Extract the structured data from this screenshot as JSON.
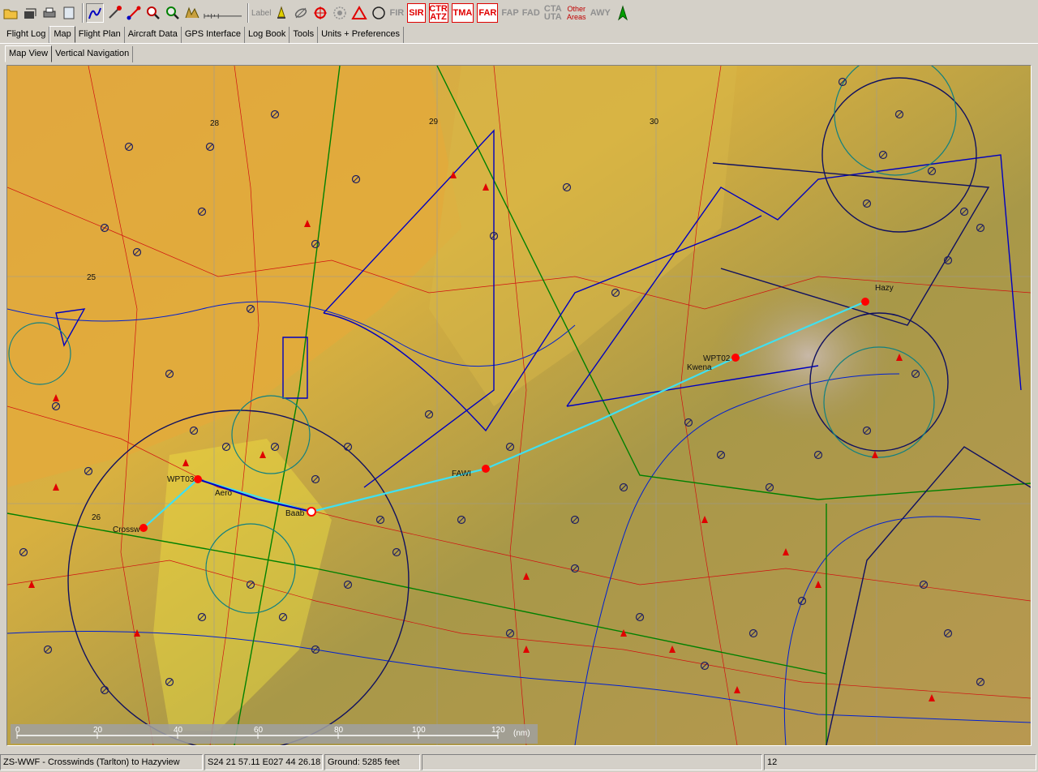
{
  "toolbar": {
    "label_tool": "Label",
    "airspace_buttons": [
      "FIR",
      "SIR",
      "CTR ATZ",
      "TMA",
      "FAR",
      "FAP",
      "FAD",
      "CTA UTA",
      "Other Areas",
      "AWY"
    ],
    "icons": [
      "open-folder-icon",
      "open-file-icon",
      "print-icon",
      "page-setup-icon",
      "route-draw-icon",
      "route-edit-icon",
      "line-tool-icon",
      "zoom-in-icon",
      "zoom-out-icon",
      "terrain-icon",
      "scale-bar-icon",
      "airport-icon",
      "airfield-icon",
      "navaid-vor-icon",
      "navaid-ndb-icon",
      "triangle-icon",
      "circle-icon",
      "north-arrow-icon"
    ]
  },
  "main_tabs": [
    "Flight Log",
    "Map",
    "Flight Plan",
    "Aircraft Data",
    "GPS Interface",
    "Log Book",
    "Tools",
    "Units + Preferences"
  ],
  "active_main_tab": "Map",
  "sub_tabs": [
    "Map View",
    "Vertical Navigation"
  ],
  "active_sub_tab": "Map View",
  "map": {
    "grid_labels": [
      "28",
      "29",
      "30",
      "25",
      "26"
    ],
    "waypoints": [
      "Crossw",
      "WPT03",
      "Aero",
      "Baab",
      "FAWI",
      "WPT02",
      "Kwena",
      "Hazy"
    ],
    "scale_ticks": [
      "0",
      "20",
      "40",
      "60",
      "80",
      "100",
      "120"
    ],
    "scale_unit": "(nm)",
    "colors": {
      "route": "#40e0f0",
      "ctr": "#0000c0",
      "fir": "#008000",
      "roads": "#e00000",
      "waypoint": "#ff0000"
    }
  },
  "status": {
    "flight": "ZS-WWF - Crosswinds (Tarlton) to Hazyview",
    "position": "S24 21 57.11  E027 44 26.18",
    "ground": "Ground: 5285 feet",
    "zoom": "12"
  }
}
